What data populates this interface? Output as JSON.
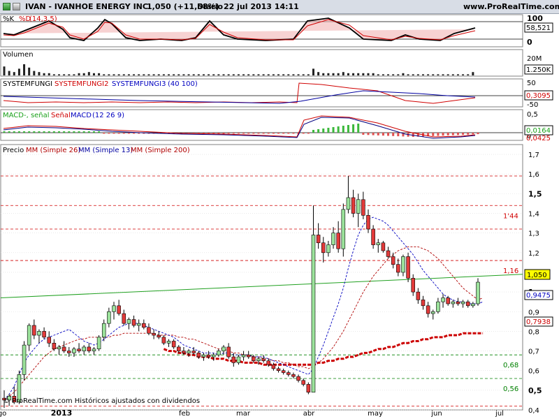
{
  "header": {
    "ticker_name": "IVAN - IVANHOE ENERGY INC.",
    "price_change": "1,050 (+11,58%)",
    "period": "Diario",
    "datetime": "22 jul 2013 14:11",
    "site": "www.ProRealTime.com"
  },
  "footer": {
    "copyright": "© ProRealTime.com Históricos ajustados con dividendos"
  },
  "colors": {
    "green": "#008000",
    "red": "#d00000",
    "blue": "#0000c0",
    "darkred": "#cc0000",
    "navy": "#000080",
    "grid": "#c0c0c0"
  },
  "chart_data": [
    {
      "type": "line",
      "panel": "stochastic",
      "title_parts": [
        "%K",
        "%D",
        "(14,3,5)"
      ],
      "ylim": [
        0,
        100
      ],
      "ticks": [
        "100",
        "0"
      ],
      "last_value": "58,521"
    },
    {
      "type": "bar",
      "panel": "volume",
      "title": "Volumen",
      "ticks": [
        "20M"
      ],
      "last_value": "1.250K"
    },
    {
      "type": "line",
      "panel": "systemfungi",
      "title_parts": [
        "SYSTEMFUNGI",
        "SYSTEMFUNGI2",
        "SYSTEMFUNGI3",
        "(40 100)"
      ],
      "ticks": [
        "50",
        "0",
        "-50"
      ],
      "last_value": "0,3095"
    },
    {
      "type": "bar",
      "panel": "macd",
      "title_parts": [
        "MACD-, señal",
        "Señal",
        "MACD",
        "(12 26 9)"
      ],
      "ticks": [
        "0,5",
        "0"
      ],
      "last_value": "0,0164",
      "second_value": "0,0425"
    },
    {
      "type": "line",
      "panel": "price",
      "title_parts": [
        "Precio",
        "MM (Simple 26)",
        "MM (Simple 13)",
        "MM (Simple 200)"
      ],
      "ylim": [
        0.4,
        1.75
      ],
      "yticks": [
        "1,7",
        "1,6",
        "1,5",
        "1,4",
        "1,3",
        "1,2",
        "1,1",
        "1",
        "0,9",
        "0,8",
        "0,7",
        "0,6",
        "0,5",
        "0,4"
      ],
      "x_months": [
        "2013",
        "feb",
        "mar",
        "abr",
        "may",
        "jun",
        "jul",
        "ago"
      ],
      "hlines": [
        {
          "value": 1.59,
          "label": ""
        },
        {
          "value": 1.44,
          "label": "1'44"
        },
        {
          "value": 1.32,
          "label": ""
        },
        {
          "value": 1.16,
          "label": "1,16"
        },
        {
          "value": 0.68,
          "label": "0,68"
        },
        {
          "value": 0.56,
          "label": "0,56"
        },
        {
          "value": 0.42,
          "label": ""
        }
      ],
      "trendline": {
        "y_start": 0.97,
        "y_end": 1.09
      },
      "candles": [
        {
          "o": 0.46,
          "h": 0.5,
          "l": 0.41,
          "c": 0.45
        },
        {
          "o": 0.45,
          "h": 0.48,
          "l": 0.42,
          "c": 0.47
        },
        {
          "o": 0.47,
          "h": 0.52,
          "l": 0.43,
          "c": 0.44
        },
        {
          "o": 0.44,
          "h": 0.6,
          "l": 0.43,
          "c": 0.58
        },
        {
          "o": 0.58,
          "h": 0.75,
          "l": 0.55,
          "c": 0.73
        },
        {
          "o": 0.73,
          "h": 0.84,
          "l": 0.7,
          "c": 0.83
        },
        {
          "o": 0.83,
          "h": 0.86,
          "l": 0.76,
          "c": 0.78
        },
        {
          "o": 0.78,
          "h": 0.81,
          "l": 0.74,
          "c": 0.8
        },
        {
          "o": 0.8,
          "h": 0.82,
          "l": 0.76,
          "c": 0.77
        },
        {
          "o": 0.77,
          "h": 0.8,
          "l": 0.72,
          "c": 0.74
        },
        {
          "o": 0.74,
          "h": 0.76,
          "l": 0.7,
          "c": 0.71
        },
        {
          "o": 0.71,
          "h": 0.73,
          "l": 0.68,
          "c": 0.72
        },
        {
          "o": 0.72,
          "h": 0.75,
          "l": 0.69,
          "c": 0.7
        },
        {
          "o": 0.7,
          "h": 0.72,
          "l": 0.67,
          "c": 0.69
        },
        {
          "o": 0.69,
          "h": 0.72,
          "l": 0.67,
          "c": 0.71
        },
        {
          "o": 0.71,
          "h": 0.74,
          "l": 0.69,
          "c": 0.7
        },
        {
          "o": 0.7,
          "h": 0.73,
          "l": 0.68,
          "c": 0.72
        },
        {
          "o": 0.72,
          "h": 0.74,
          "l": 0.69,
          "c": 0.7
        },
        {
          "o": 0.7,
          "h": 0.72,
          "l": 0.68,
          "c": 0.71
        },
        {
          "o": 0.71,
          "h": 0.78,
          "l": 0.7,
          "c": 0.77
        },
        {
          "o": 0.77,
          "h": 0.86,
          "l": 0.75,
          "c": 0.84
        },
        {
          "o": 0.84,
          "h": 0.92,
          "l": 0.82,
          "c": 0.9
        },
        {
          "o": 0.9,
          "h": 0.95,
          "l": 0.86,
          "c": 0.93
        },
        {
          "o": 0.93,
          "h": 0.96,
          "l": 0.88,
          "c": 0.89
        },
        {
          "o": 0.89,
          "h": 0.91,
          "l": 0.83,
          "c": 0.84
        },
        {
          "o": 0.84,
          "h": 0.87,
          "l": 0.81,
          "c": 0.86
        },
        {
          "o": 0.86,
          "h": 0.88,
          "l": 0.82,
          "c": 0.83
        },
        {
          "o": 0.83,
          "h": 0.86,
          "l": 0.8,
          "c": 0.84
        },
        {
          "o": 0.84,
          "h": 0.86,
          "l": 0.81,
          "c": 0.82
        },
        {
          "o": 0.82,
          "h": 0.84,
          "l": 0.78,
          "c": 0.79
        },
        {
          "o": 0.79,
          "h": 0.81,
          "l": 0.76,
          "c": 0.78
        },
        {
          "o": 0.78,
          "h": 0.8,
          "l": 0.76,
          "c": 0.77
        },
        {
          "o": 0.77,
          "h": 0.78,
          "l": 0.73,
          "c": 0.74
        },
        {
          "o": 0.74,
          "h": 0.76,
          "l": 0.72,
          "c": 0.75
        },
        {
          "o": 0.75,
          "h": 0.76,
          "l": 0.71,
          "c": 0.72
        },
        {
          "o": 0.72,
          "h": 0.73,
          "l": 0.69,
          "c": 0.7
        },
        {
          "o": 0.7,
          "h": 0.72,
          "l": 0.68,
          "c": 0.69
        },
        {
          "o": 0.69,
          "h": 0.71,
          "l": 0.67,
          "c": 0.7
        },
        {
          "o": 0.7,
          "h": 0.72,
          "l": 0.68,
          "c": 0.69
        },
        {
          "o": 0.69,
          "h": 0.7,
          "l": 0.66,
          "c": 0.67
        },
        {
          "o": 0.67,
          "h": 0.69,
          "l": 0.65,
          "c": 0.68
        },
        {
          "o": 0.68,
          "h": 0.7,
          "l": 0.66,
          "c": 0.67
        },
        {
          "o": 0.67,
          "h": 0.69,
          "l": 0.65,
          "c": 0.68
        },
        {
          "o": 0.68,
          "h": 0.71,
          "l": 0.67,
          "c": 0.7
        },
        {
          "o": 0.7,
          "h": 0.73,
          "l": 0.68,
          "c": 0.72
        },
        {
          "o": 0.72,
          "h": 0.74,
          "l": 0.66,
          "c": 0.67
        },
        {
          "o": 0.67,
          "h": 0.69,
          "l": 0.62,
          "c": 0.64
        },
        {
          "o": 0.64,
          "h": 0.68,
          "l": 0.63,
          "c": 0.67
        },
        {
          "o": 0.67,
          "h": 0.7,
          "l": 0.65,
          "c": 0.68
        },
        {
          "o": 0.68,
          "h": 0.7,
          "l": 0.66,
          "c": 0.67
        },
        {
          "o": 0.67,
          "h": 0.68,
          "l": 0.64,
          "c": 0.65
        },
        {
          "o": 0.65,
          "h": 0.67,
          "l": 0.63,
          "c": 0.66
        },
        {
          "o": 0.66,
          "h": 0.68,
          "l": 0.64,
          "c": 0.65
        },
        {
          "o": 0.65,
          "h": 0.66,
          "l": 0.62,
          "c": 0.63
        },
        {
          "o": 0.63,
          "h": 0.64,
          "l": 0.6,
          "c": 0.61
        },
        {
          "o": 0.61,
          "h": 0.62,
          "l": 0.59,
          "c": 0.6
        },
        {
          "o": 0.6,
          "h": 0.61,
          "l": 0.58,
          "c": 0.59
        },
        {
          "o": 0.59,
          "h": 0.6,
          "l": 0.57,
          "c": 0.58
        },
        {
          "o": 0.58,
          "h": 0.59,
          "l": 0.56,
          "c": 0.57
        },
        {
          "o": 0.57,
          "h": 0.58,
          "l": 0.54,
          "c": 0.55
        },
        {
          "o": 0.55,
          "h": 0.56,
          "l": 0.52,
          "c": 0.53
        },
        {
          "o": 0.53,
          "h": 0.54,
          "l": 0.48,
          "c": 0.49
        },
        {
          "o": 0.49,
          "h": 1.44,
          "l": 1.1,
          "c": 1.29
        },
        {
          "o": 1.29,
          "h": 1.35,
          "l": 1.22,
          "c": 1.25
        },
        {
          "o": 1.25,
          "h": 1.28,
          "l": 1.15,
          "c": 1.2
        },
        {
          "o": 1.2,
          "h": 1.26,
          "l": 1.18,
          "c": 1.24
        },
        {
          "o": 1.24,
          "h": 1.33,
          "l": 1.22,
          "c": 1.3
        },
        {
          "o": 1.3,
          "h": 1.36,
          "l": 1.2,
          "c": 1.22
        },
        {
          "o": 1.22,
          "h": 1.45,
          "l": 1.18,
          "c": 1.42
        },
        {
          "o": 1.42,
          "h": 1.59,
          "l": 1.4,
          "c": 1.48
        },
        {
          "o": 1.48,
          "h": 1.52,
          "l": 1.38,
          "c": 1.4
        },
        {
          "o": 1.4,
          "h": 1.5,
          "l": 1.33,
          "c": 1.47
        },
        {
          "o": 1.47,
          "h": 1.51,
          "l": 1.37,
          "c": 1.39
        },
        {
          "o": 1.39,
          "h": 1.42,
          "l": 1.3,
          "c": 1.32
        },
        {
          "o": 1.32,
          "h": 1.34,
          "l": 1.22,
          "c": 1.24
        },
        {
          "o": 1.24,
          "h": 1.27,
          "l": 1.2,
          "c": 1.25
        },
        {
          "o": 1.25,
          "h": 1.26,
          "l": 1.2,
          "c": 1.21
        },
        {
          "o": 1.21,
          "h": 1.23,
          "l": 1.17,
          "c": 1.18
        },
        {
          "o": 1.18,
          "h": 1.2,
          "l": 1.12,
          "c": 1.14
        },
        {
          "o": 1.14,
          "h": 1.17,
          "l": 1.08,
          "c": 1.1
        },
        {
          "o": 1.1,
          "h": 1.19,
          "l": 1.08,
          "c": 1.18
        },
        {
          "o": 1.18,
          "h": 1.2,
          "l": 1.05,
          "c": 1.07
        },
        {
          "o": 1.07,
          "h": 1.09,
          "l": 0.98,
          "c": 1.0
        },
        {
          "o": 1.0,
          "h": 1.02,
          "l": 0.94,
          "c": 0.96
        },
        {
          "o": 0.96,
          "h": 0.98,
          "l": 0.91,
          "c": 0.93
        },
        {
          "o": 0.93,
          "h": 0.95,
          "l": 0.87,
          "c": 0.89
        },
        {
          "o": 0.89,
          "h": 0.91,
          "l": 0.86,
          "c": 0.9
        },
        {
          "o": 0.9,
          "h": 0.97,
          "l": 0.89,
          "c": 0.95
        },
        {
          "o": 0.95,
          "h": 0.99,
          "l": 0.92,
          "c": 0.97
        },
        {
          "o": 0.97,
          "h": 0.98,
          "l": 0.93,
          "c": 0.94
        },
        {
          "o": 0.94,
          "h": 0.96,
          "l": 0.92,
          "c": 0.95
        },
        {
          "o": 0.95,
          "h": 0.97,
          "l": 0.93,
          "c": 0.94
        },
        {
          "o": 0.94,
          "h": 0.96,
          "l": 0.92,
          "c": 0.95
        },
        {
          "o": 0.95,
          "h": 0.96,
          "l": 0.92,
          "c": 0.93
        },
        {
          "o": 0.93,
          "h": 0.95,
          "l": 0.92,
          "c": 0.94
        },
        {
          "o": 0.94,
          "h": 1.07,
          "l": 0.93,
          "c": 1.05
        }
      ],
      "sma13": [
        0.45,
        0.48,
        0.52,
        0.58,
        0.64,
        0.68,
        0.71,
        0.74,
        0.76,
        0.77,
        0.78,
        0.79,
        0.8,
        0.81,
        0.79,
        0.77,
        0.75,
        0.74,
        0.73,
        0.74,
        0.76,
        0.78,
        0.8,
        0.82,
        0.83,
        0.84,
        0.84,
        0.84,
        0.83,
        0.82,
        0.81,
        0.8,
        0.79,
        0.78,
        0.77,
        0.75,
        0.73,
        0.72,
        0.71,
        0.7,
        0.69,
        0.69,
        0.69,
        0.68,
        0.69,
        0.69,
        0.68,
        0.68,
        0.68,
        0.68,
        0.67,
        0.67,
        0.67,
        0.66,
        0.65,
        0.64,
        0.63,
        0.62,
        0.61,
        0.6,
        0.59,
        0.58,
        0.61,
        0.67,
        0.73,
        0.8,
        0.87,
        0.94,
        1.02,
        1.12,
        1.21,
        1.29,
        1.34,
        1.37,
        1.38,
        1.37,
        1.36,
        1.34,
        1.31,
        1.28,
        1.25,
        1.22,
        1.19,
        1.15,
        1.11,
        1.08,
        1.05,
        1.02,
        0.99,
        0.97,
        0.96,
        0.95,
        0.95,
        0.94,
        0.94,
        0.94,
        0.95
      ],
      "sma26": [
        0.45,
        0.47,
        0.49,
        0.52,
        0.55,
        0.58,
        0.61,
        0.64,
        0.67,
        0.69,
        0.71,
        0.72,
        0.73,
        0.74,
        0.75,
        0.76,
        0.76,
        0.77,
        0.77,
        0.77,
        0.77,
        0.77,
        0.78,
        0.78,
        0.79,
        0.79,
        0.79,
        0.79,
        0.79,
        0.79,
        0.79,
        0.78,
        0.78,
        0.78,
        0.78,
        0.77,
        0.77,
        0.76,
        0.76,
        0.75,
        0.74,
        0.73,
        0.72,
        0.71,
        0.71,
        0.7,
        0.69,
        0.69,
        0.68,
        0.68,
        0.67,
        0.67,
        0.66,
        0.66,
        0.65,
        0.65,
        0.64,
        0.64,
        0.63,
        0.62,
        0.62,
        0.61,
        0.62,
        0.64,
        0.66,
        0.69,
        0.72,
        0.76,
        0.8,
        0.85,
        0.9,
        0.95,
        1.0,
        1.04,
        1.08,
        1.11,
        1.14,
        1.17,
        1.19,
        1.21,
        1.22,
        1.23,
        1.23,
        1.23,
        1.22,
        1.21,
        1.19,
        1.17,
        1.14,
        1.11,
        1.08,
        1.05,
        1.02,
        1.0,
        0.98,
        0.96,
        0.97
      ],
      "sma200": [
        null,
        null,
        null,
        null,
        null,
        null,
        null,
        null,
        null,
        null,
        null,
        null,
        null,
        null,
        null,
        null,
        null,
        null,
        null,
        null,
        null,
        null,
        null,
        null,
        null,
        null,
        null,
        null,
        null,
        null,
        null,
        null,
        0.71,
        0.7,
        0.7,
        0.69,
        0.69,
        0.68,
        0.68,
        0.67,
        0.67,
        0.67,
        0.66,
        0.66,
        0.66,
        0.65,
        0.65,
        0.65,
        0.64,
        0.64,
        0.64,
        0.64,
        0.63,
        0.63,
        0.63,
        0.63,
        0.63,
        0.63,
        0.63,
        0.63,
        0.63,
        0.63,
        0.63,
        0.64,
        0.64,
        0.65,
        0.65,
        0.66,
        0.66,
        0.67,
        0.67,
        0.68,
        0.69,
        0.69,
        0.7,
        0.71,
        0.71,
        0.72,
        0.72,
        0.73,
        0.74,
        0.74,
        0.75,
        0.75,
        0.76,
        0.76,
        0.77,
        0.77,
        0.77,
        0.78,
        0.78,
        0.78,
        0.79,
        0.79,
        0.79,
        0.79,
        0.79
      ],
      "last_price": "1,050",
      "sma13_last": "0,9475",
      "sma200_last": "0,7938"
    }
  ]
}
